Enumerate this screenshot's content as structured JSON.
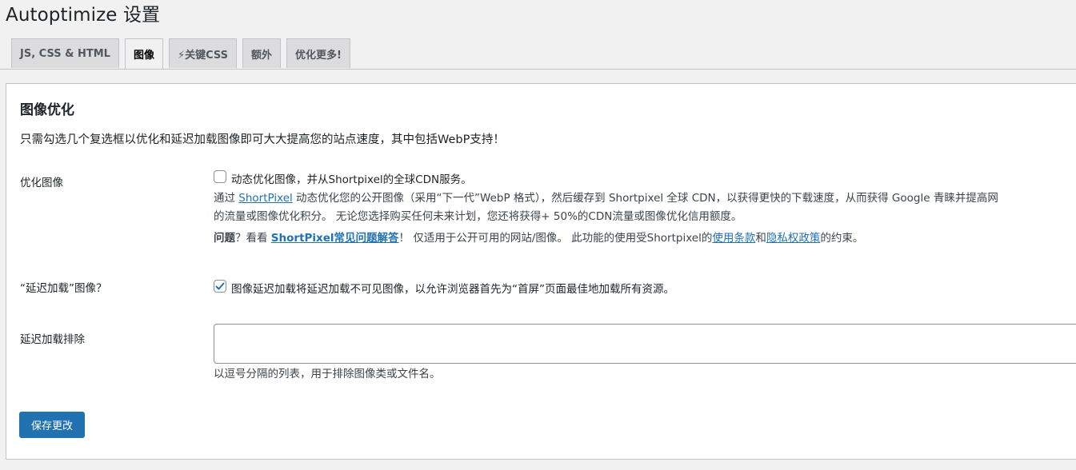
{
  "page": {
    "title": "Autoptimize 设置"
  },
  "tabs": [
    {
      "label": "JS, CSS & HTML",
      "active": false
    },
    {
      "label": "图像",
      "active": true
    },
    {
      "label": "⚡关键CSS",
      "active": false
    },
    {
      "label": "额外",
      "active": false
    },
    {
      "label": "优化更多!",
      "active": false
    }
  ],
  "section": {
    "title": "图像优化",
    "description": "只需勾选几个复选框以优化和延迟加载图像即可大大提高您的站点速度，其中包括WebP支持！"
  },
  "optimize": {
    "label": "优化图像",
    "checkbox_label": "动态优化图像，并从Shortpixel的全球CDN服务。",
    "checked": false,
    "desc_prefix": "通过 ",
    "desc_link": "ShortPixel",
    "desc_line1_rest": " 动态优化您的公开图像（采用“下一代”WebP 格式），然后缓存到 Shortpixel 全球 CDN，以获得更快的下载速度，从而获得 Google 青睐并提高网",
    "desc_line2": "的流量或图像优化积分。 无论您选择购买任何未来计划，您还将获得+ 50%的CDN流量或图像优化信用额度。",
    "faq_prefix": "问题",
    "faq_mid": "？看看 ",
    "faq_link": "ShortPixel常见问题解答",
    "faq_after": "！ 仅适用于公开可用的网站/图像。 此功能的使用受Shortpixel的",
    "terms_link": "使用条款",
    "and": "和",
    "privacy_link": "隐私权政策",
    "suffix": "的约束。"
  },
  "lazyload": {
    "label": "“延迟加载”图像？",
    "checkbox_label": "图像延迟加载将延迟加载不可见图像，以允许浏览器首先为“首屏”页面最佳地加载所有资源。",
    "checked": true
  },
  "exclusions": {
    "label": "延迟加载排除",
    "value": "",
    "help": "以逗号分隔的列表，用于排除图像类或文件名。"
  },
  "save_button": {
    "label": "保存更改"
  },
  "colors": {
    "primary": "#2271b1",
    "checkmark": "#2271b1"
  }
}
